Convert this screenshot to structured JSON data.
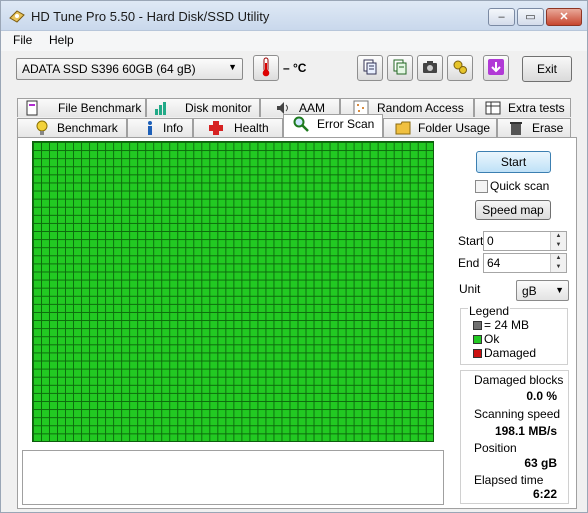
{
  "window": {
    "title": "HD Tune Pro 5.50 - Hard Disk/SSD Utility",
    "min_label": "–",
    "max_label": "▭",
    "close_label": "✕"
  },
  "menu": {
    "file": "File",
    "help": "Help"
  },
  "toolbar": {
    "drive": "ADATA SSD S396 60GB (64 gB)",
    "temperature": "– °C",
    "exit_label": "Exit"
  },
  "tabs_top": [
    {
      "label": "File Benchmark",
      "icon": "file-benchmark-icon"
    },
    {
      "label": "Disk monitor",
      "icon": "disk-monitor-icon"
    },
    {
      "label": "AAM",
      "icon": "speaker-icon"
    },
    {
      "label": "Random Access",
      "icon": "random-access-icon"
    },
    {
      "label": "Extra tests",
      "icon": "extra-tests-icon"
    }
  ],
  "tabs_bottom": [
    {
      "label": "Benchmark",
      "icon": "benchmark-icon"
    },
    {
      "label": "Info",
      "icon": "info-icon"
    },
    {
      "label": "Health",
      "icon": "health-cross-icon"
    },
    {
      "label": "Error Scan",
      "icon": "magnifier-icon",
      "active": true
    },
    {
      "label": "Folder Usage",
      "icon": "folder-icon"
    },
    {
      "label": "Erase",
      "icon": "trash-icon"
    }
  ],
  "controls": {
    "start_label": "Start",
    "quick_scan_label": "Quick scan",
    "quick_scan_checked": false,
    "speed_map_label": "Speed map",
    "start_field_label": "Start",
    "start_value": "0",
    "end_field_label": "End",
    "end_value": "64",
    "unit_label": "Unit",
    "unit_value": "gB"
  },
  "legend": {
    "title": "Legend",
    "block_size": "= 24 MB",
    "ok": "Ok",
    "damaged": "Damaged",
    "colors": {
      "block": "#707070",
      "ok": "#22c922",
      "damaged": "#cc1111"
    }
  },
  "stats": {
    "damaged_label": "Damaged blocks",
    "damaged_value": "0.0 %",
    "speed_label": "Scanning speed",
    "speed_value": "198.1 MB/s",
    "position_label": "Position",
    "position_value": "63 gB",
    "elapsed_label": "Elapsed time",
    "elapsed_value": "6:22"
  },
  "scan_result": {
    "all_blocks_status": "ok",
    "color": "#22c922"
  }
}
